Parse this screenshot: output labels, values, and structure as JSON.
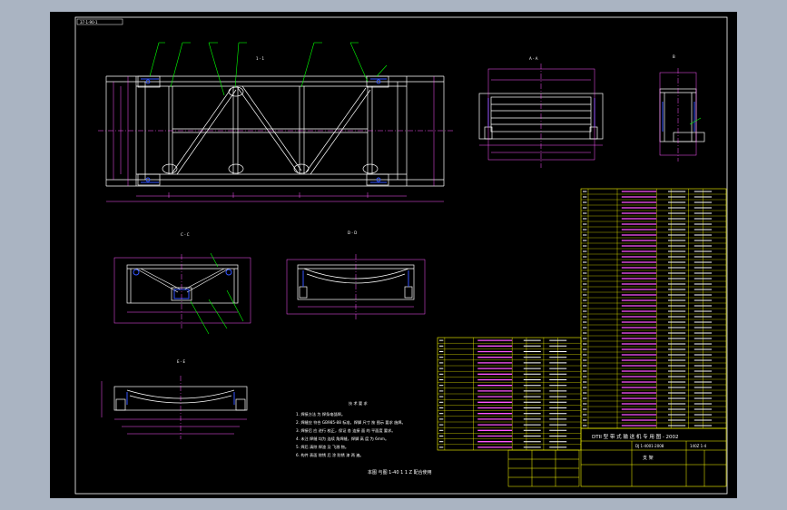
{
  "drawing": {
    "corner_stamp": "37-1-90-1",
    "views": {
      "main": "1 - 1",
      "section_a": "A - A",
      "section_b": "B",
      "section_c": "C - C",
      "section_d": "D - D",
      "section_e": "E - E"
    },
    "notes_heading": "技 术 要 求",
    "notes": [
      "1. 焊接方法 为 焊条电弧焊。",
      "2. 焊缝应 符合 GB985-88 标准，焊脚 尺寸 按 图示 要求 施焊。",
      "3. 焊接后 应 进行 校正，保证 各 连接 面 的 平面度 要求。",
      "4. 未注 焊缝 均为 连续 角焊缝，焊脚 高 度 为 6mm。",
      "5. 焊后 清除 焊渣 及 飞溅 物。",
      "6. 构件 表面 除锈 后 涂 防锈 漆 两 遍。"
    ],
    "bottom_caption": "本图 与图 1-40 1 1 Z 配合使用",
    "title_block": {
      "title": "DTII 型 带 式 输 送 机 专 用 图 - 2002",
      "drawing_no": "DJ 1-4001-2008",
      "part_no": "140Z 1-4",
      "name": "支 架"
    }
  },
  "colors": {
    "background": "#000000",
    "frame": "#ffffff",
    "structure": "#ffffff",
    "dimension": "#ff55ff",
    "leader": "#00ff00",
    "table_border": "#ffff00",
    "hidden": "#3355ff",
    "outer": "#aab4c2"
  },
  "icons": [
    "window-frame"
  ]
}
